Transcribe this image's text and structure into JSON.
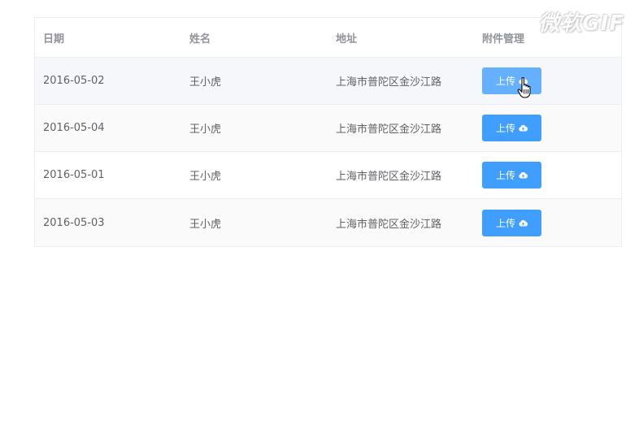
{
  "table": {
    "columns": {
      "date": "日期",
      "name": "姓名",
      "address": "地址",
      "actions": "附件管理"
    },
    "rows": [
      {
        "date": "2016-05-02",
        "name": "王小虎",
        "address": "上海市普陀区金沙江路",
        "upload_label": "上传"
      },
      {
        "date": "2016-05-04",
        "name": "王小虎",
        "address": "上海市普陀区金沙江路",
        "upload_label": "上传"
      },
      {
        "date": "2016-05-01",
        "name": "王小虎",
        "address": "上海市普陀区金沙江路",
        "upload_label": "上传"
      },
      {
        "date": "2016-05-03",
        "name": "王小虎",
        "address": "上海市普陀区金沙江路",
        "upload_label": "上传"
      }
    ]
  },
  "icons": {
    "upload": "cloud-upload-icon",
    "cursor": "hand-pointer-icon"
  },
  "colors": {
    "primary": "#409eff",
    "primary_hover": "#66b1ff",
    "header_text": "#909399",
    "body_text": "#606266",
    "border": "#ebeef5",
    "row_hover": "#f5f7fa",
    "row_stripe": "#fafafa"
  },
  "watermark": "微软GIF"
}
